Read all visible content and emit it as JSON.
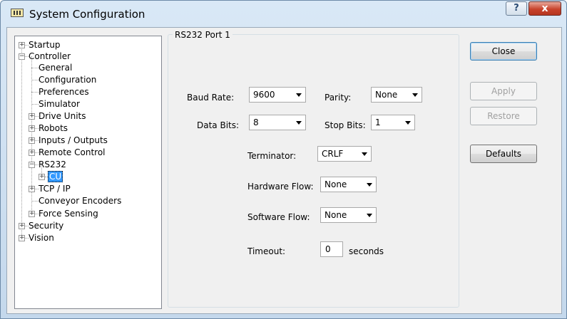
{
  "window": {
    "title": "System Configuration",
    "help_glyph": "?",
    "close_glyph": "x"
  },
  "tree": {
    "items": [
      {
        "label": "Startup"
      },
      {
        "label": "Controller"
      },
      {
        "label": "General"
      },
      {
        "label": "Configuration"
      },
      {
        "label": "Preferences"
      },
      {
        "label": "Simulator"
      },
      {
        "label": "Drive Units"
      },
      {
        "label": "Robots"
      },
      {
        "label": "Inputs / Outputs"
      },
      {
        "label": "Remote Control"
      },
      {
        "label": "RS232"
      },
      {
        "label": "CU"
      },
      {
        "label": "TCP / IP"
      },
      {
        "label": "Conveyor Encoders"
      },
      {
        "label": "Force Sensing"
      },
      {
        "label": "Security"
      },
      {
        "label": "Vision"
      }
    ],
    "selected": "CU"
  },
  "port": {
    "group_title": "RS232 Port 1",
    "baud_rate": {
      "label": "Baud Rate:",
      "value": "9600"
    },
    "parity": {
      "label": "Parity:",
      "value": "None"
    },
    "data_bits": {
      "label": "Data Bits:",
      "value": "8"
    },
    "stop_bits": {
      "label": "Stop Bits:",
      "value": "1"
    },
    "terminator": {
      "label": "Terminator:",
      "value": "CRLF"
    },
    "hardware_flow": {
      "label": "Hardware Flow:",
      "value": "None"
    },
    "software_flow": {
      "label": "Software Flow:",
      "value": "None"
    },
    "timeout": {
      "label": "Timeout:",
      "value": "0",
      "unit": "seconds"
    }
  },
  "buttons": {
    "close": "Close",
    "apply": "Apply",
    "restore": "Restore",
    "defaults": "Defaults"
  }
}
